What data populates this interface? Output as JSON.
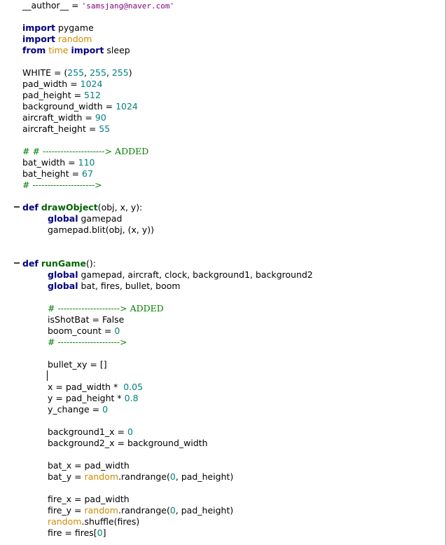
{
  "code_lines": {
    "l1": [
      "__author__ = ",
      "'samsjang@naver.com'"
    ],
    "l3": [
      "import",
      " pygame"
    ],
    "l4": [
      "import",
      " ",
      "random"
    ],
    "l5": [
      "from",
      " ",
      "time",
      " ",
      "import",
      " sleep"
    ],
    "l7": [
      "WHITE = (",
      "255",
      ", ",
      "255",
      ", ",
      "255",
      ")"
    ],
    "l8": [
      "pad_width = ",
      "1024"
    ],
    "l9": [
      "pad_height = ",
      "512"
    ],
    "l10": [
      "background_width = ",
      "1024"
    ],
    "l11": [
      "aircraft_width = ",
      "90"
    ],
    "l12": [
      "aircraft_height = ",
      "55"
    ],
    "l14": [
      "# # ---------------------> ADDED"
    ],
    "l15": [
      "bat_width = ",
      "110"
    ],
    "l16": [
      "bat_height = ",
      "67"
    ],
    "l17": [
      "# --------------------->"
    ],
    "l19": [
      "def",
      " ",
      "drawObject",
      "(obj, x, y):"
    ],
    "l20": [
      "global",
      " gamepad"
    ],
    "l21": [
      "gamepad.blit(obj, (x, y))"
    ],
    "l24": [
      "def",
      " ",
      "runGame",
      "():"
    ],
    "l25": [
      "global",
      " gamepad, aircraft, clock, background1, background2"
    ],
    "l26": [
      "global",
      " bat, fires, bullet, boom"
    ],
    "l28": [
      "# ---------------------> ADDED"
    ],
    "l29": [
      "isShotBat = False"
    ],
    "l30": [
      "boom_count = ",
      "0"
    ],
    "l31": [
      "# --------------------->"
    ],
    "l33": [
      "bullet_xy = []"
    ],
    "l35": [
      "x = pad_width *  ",
      "0.05"
    ],
    "l36": [
      "y = pad_height * ",
      "0.8"
    ],
    "l37": [
      "y_change = ",
      "0"
    ],
    "l39": [
      "background1_x = ",
      "0"
    ],
    "l40": [
      "background2_x = background_width"
    ],
    "l42": [
      "bat_x = pad_width"
    ],
    "l43": [
      "bat_y = ",
      "random",
      ".randrange(",
      "0",
      ", pad_height)"
    ],
    "l45": [
      "fire_x = pad_width"
    ],
    "l46": [
      "fire_y = ",
      "random",
      ".randrange(",
      "0",
      ", pad_height)"
    ],
    "l47": [
      "random",
      ".shuffle(fires)"
    ],
    "l48": [
      "fire = fires[",
      "0",
      "]"
    ]
  },
  "icons": {
    "fold": "fold-collapse-icon"
  }
}
